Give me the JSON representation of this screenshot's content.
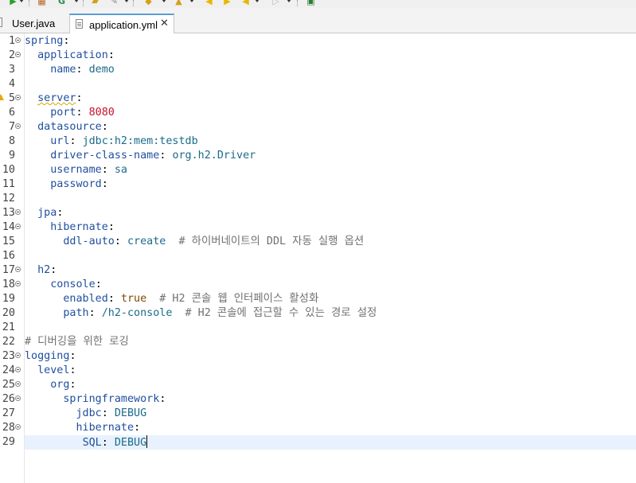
{
  "tabs": [
    {
      "label": "User.java",
      "active": false
    },
    {
      "label": "application.yml",
      "active": true
    }
  ],
  "toolbar": {
    "icons": [
      "run-icon",
      "package-icon",
      "gradle-icon",
      "folder-open-icon",
      "pin-icon",
      "annotation-icon",
      "up-arrow-icon",
      "back-icon",
      "forward-icon",
      "back-nav-icon",
      "forward-nav-icon",
      "new-window-icon"
    ]
  },
  "colors": {
    "key": "#1f4e9e",
    "value": "#1a6b8a",
    "number": "#c8102e",
    "boolean": "#7a4a00",
    "comment": "#707070",
    "current_line": "#e8f2fe",
    "active_tab_border": "#5b9bd5"
  },
  "lines": [
    {
      "n": "1",
      "fold": true,
      "indent": "",
      "key": "spring",
      "sep": ":",
      "val": "",
      "vtype": "",
      "comment": ""
    },
    {
      "n": "2",
      "fold": true,
      "indent": "  ",
      "key": "application",
      "sep": ":",
      "val": "",
      "vtype": "",
      "comment": ""
    },
    {
      "n": "3",
      "fold": false,
      "indent": "    ",
      "key": "name",
      "sep": ": ",
      "val": "demo",
      "vtype": "v",
      "comment": ""
    },
    {
      "n": "4",
      "fold": false,
      "indent": "",
      "key": "",
      "sep": "",
      "val": "",
      "vtype": "",
      "comment": ""
    },
    {
      "n": "5",
      "fold": true,
      "indent": "  ",
      "key": "server",
      "sep": ":",
      "val": "",
      "vtype": "",
      "comment": "",
      "warn": true
    },
    {
      "n": "6",
      "fold": false,
      "indent": "    ",
      "key": "port",
      "sep": ": ",
      "val": "8080",
      "vtype": "num",
      "comment": ""
    },
    {
      "n": "7",
      "fold": true,
      "indent": "  ",
      "key": "datasource",
      "sep": ":",
      "val": "",
      "vtype": "",
      "comment": ""
    },
    {
      "n": "8",
      "fold": false,
      "indent": "    ",
      "key": "url",
      "sep": ": ",
      "val": "jdbc:h2:mem:testdb",
      "vtype": "v",
      "comment": ""
    },
    {
      "n": "9",
      "fold": false,
      "indent": "    ",
      "key": "driver-class-name",
      "sep": ": ",
      "val": "org.h2.Driver",
      "vtype": "v",
      "comment": ""
    },
    {
      "n": "10",
      "fold": false,
      "indent": "    ",
      "key": "username",
      "sep": ": ",
      "val": "sa",
      "vtype": "v",
      "comment": ""
    },
    {
      "n": "11",
      "fold": false,
      "indent": "    ",
      "key": "password",
      "sep": ":",
      "val": "",
      "vtype": "",
      "comment": ""
    },
    {
      "n": "12",
      "fold": false,
      "indent": "",
      "key": "",
      "sep": "",
      "val": "",
      "vtype": "",
      "comment": ""
    },
    {
      "n": "13",
      "fold": true,
      "indent": "  ",
      "key": "jpa",
      "sep": ":",
      "val": "",
      "vtype": "",
      "comment": ""
    },
    {
      "n": "14",
      "fold": true,
      "indent": "    ",
      "key": "hibernate",
      "sep": ":",
      "val": "",
      "vtype": "",
      "comment": ""
    },
    {
      "n": "15",
      "fold": false,
      "indent": "      ",
      "key": "ddl-auto",
      "sep": ": ",
      "val": "create",
      "vtype": "v",
      "comment": "  # 하이버네이트의 DDL 자동 실행 옵션"
    },
    {
      "n": "16",
      "fold": false,
      "indent": "",
      "key": "",
      "sep": "",
      "val": "",
      "vtype": "",
      "comment": ""
    },
    {
      "n": "17",
      "fold": true,
      "indent": "  ",
      "key": "h2",
      "sep": ":",
      "val": "",
      "vtype": "",
      "comment": ""
    },
    {
      "n": "18",
      "fold": true,
      "indent": "    ",
      "key": "console",
      "sep": ":",
      "val": "",
      "vtype": "",
      "comment": ""
    },
    {
      "n": "19",
      "fold": false,
      "indent": "      ",
      "key": "enabled",
      "sep": ": ",
      "val": "true",
      "vtype": "bool",
      "comment": "  # H2 콘솔 웹 인터페이스 활성화"
    },
    {
      "n": "20",
      "fold": false,
      "indent": "      ",
      "key": "path",
      "sep": ": ",
      "val": "/h2-console",
      "vtype": "v",
      "comment": "  # H2 콘솔에 접근할 수 있는 경로 설정"
    },
    {
      "n": "21",
      "fold": false,
      "indent": "",
      "key": "",
      "sep": "",
      "val": "",
      "vtype": "",
      "comment": ""
    },
    {
      "n": "22",
      "fold": false,
      "indent": "",
      "key": "",
      "sep": "",
      "val": "",
      "vtype": "",
      "comment": "# 디버깅을 위한 로깅"
    },
    {
      "n": "23",
      "fold": true,
      "indent": "",
      "key": "logging",
      "sep": ":",
      "val": "",
      "vtype": "",
      "comment": ""
    },
    {
      "n": "24",
      "fold": true,
      "indent": "  ",
      "key": "level",
      "sep": ":",
      "val": "",
      "vtype": "",
      "comment": ""
    },
    {
      "n": "25",
      "fold": true,
      "indent": "    ",
      "key": "org",
      "sep": ":",
      "val": "",
      "vtype": "",
      "comment": ""
    },
    {
      "n": "26",
      "fold": true,
      "indent": "      ",
      "key": "springframework",
      "sep": ":",
      "val": "",
      "vtype": "",
      "comment": ""
    },
    {
      "n": "27",
      "fold": false,
      "indent": "        ",
      "key": "jdbc",
      "sep": ": ",
      "val": "DEBUG",
      "vtype": "v",
      "comment": ""
    },
    {
      "n": "28",
      "fold": true,
      "indent": "        ",
      "key": "hibernate",
      "sep": ":",
      "val": "",
      "vtype": "",
      "comment": ""
    },
    {
      "n": "29",
      "fold": false,
      "indent": "         ",
      "key": "SQL",
      "sep": ": ",
      "val": "DEBUG",
      "vtype": "v",
      "comment": "",
      "current": true
    }
  ]
}
